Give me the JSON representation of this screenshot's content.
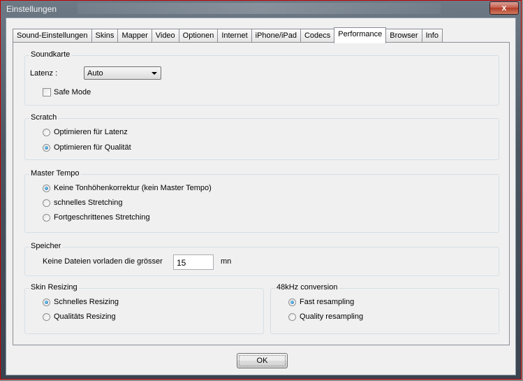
{
  "window": {
    "title": "Einstellungen",
    "close_label": "x"
  },
  "tabs": [
    {
      "label": "Sound-Einstellungen"
    },
    {
      "label": "Skins"
    },
    {
      "label": "Mapper"
    },
    {
      "label": "Video"
    },
    {
      "label": "Optionen"
    },
    {
      "label": "Internet"
    },
    {
      "label": "iPhone/iPad"
    },
    {
      "label": "Codecs"
    },
    {
      "label": "Performance",
      "active": true
    },
    {
      "label": "Browser"
    },
    {
      "label": "Info"
    }
  ],
  "soundkarte": {
    "title": "Soundkarte",
    "latenz_label": "Latenz :",
    "latenz_value": "Auto",
    "safe_mode_label": "Safe Mode",
    "safe_mode_checked": false
  },
  "scratch": {
    "title": "Scratch",
    "options": [
      {
        "label": "Optimieren für Latenz",
        "selected": false
      },
      {
        "label": "Optimieren für Qualität",
        "selected": true
      }
    ]
  },
  "master_tempo": {
    "title": "Master Tempo",
    "options": [
      {
        "label": "Keine Tonhöhenkorrektur (kein Master Tempo)",
        "selected": true
      },
      {
        "label": "schnelles Stretching",
        "selected": false
      },
      {
        "label": "Fortgeschrittenes Stretching",
        "selected": false
      }
    ]
  },
  "speicher": {
    "title": "Speicher",
    "label": "Keine Dateien vorladen die grösser",
    "value": "15",
    "unit": "mn"
  },
  "skin_resizing": {
    "title": "Skin Resizing",
    "options": [
      {
        "label": "Schnelles Resizing",
        "selected": true
      },
      {
        "label": "Qualitäts Resizing",
        "selected": false
      }
    ]
  },
  "conversion": {
    "title": "48kHz conversion",
    "options": [
      {
        "label": "Fast resampling",
        "selected": true
      },
      {
        "label": "Quality resampling",
        "selected": false
      }
    ]
  },
  "ok_label": "OK"
}
